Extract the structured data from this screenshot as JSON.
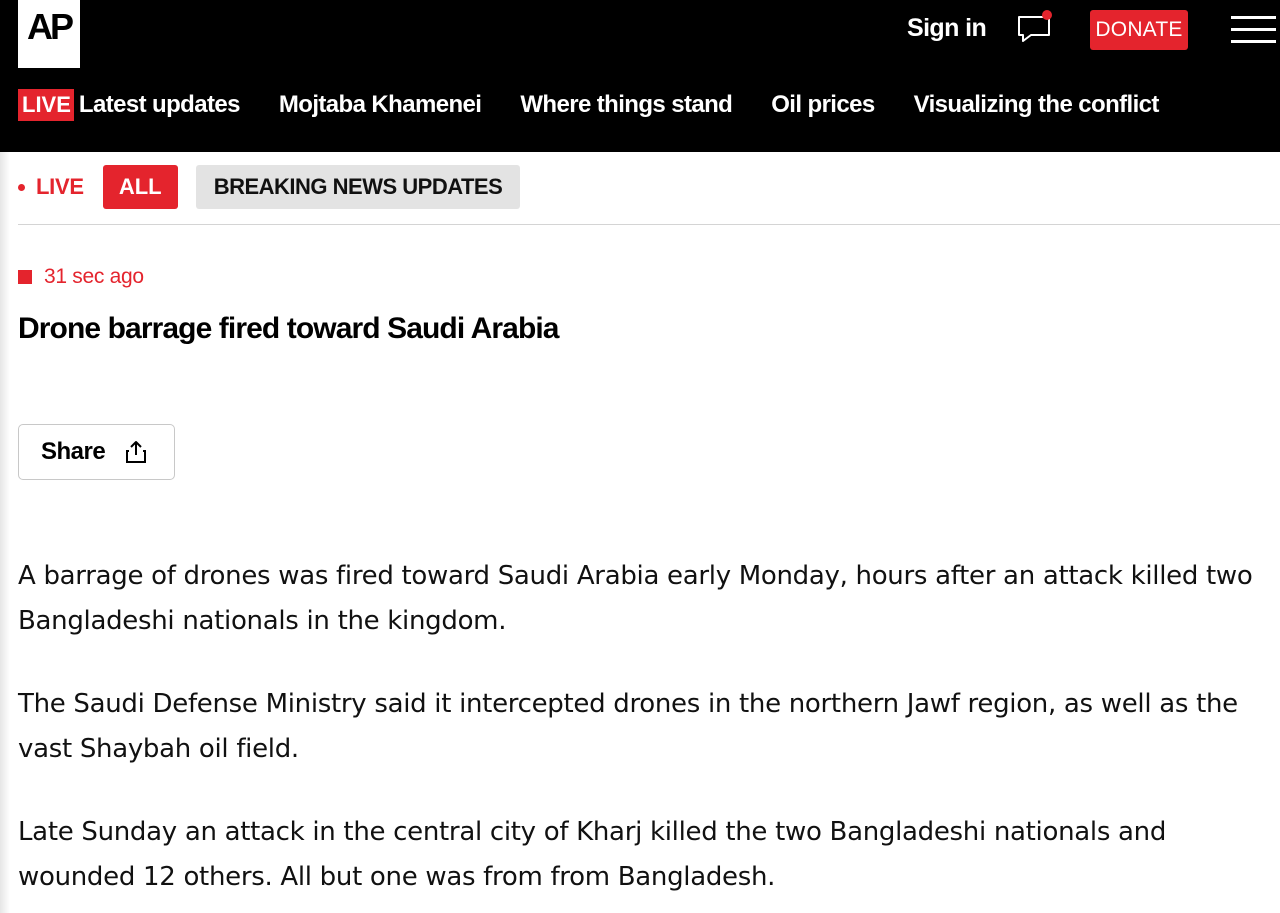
{
  "header": {
    "logo_text": "AP",
    "sign_in_label": "Sign in",
    "donate_label": "DONATE",
    "accent_color": "#e4242d",
    "icons": [
      "comments-icon",
      "hamburger-menu-icon"
    ]
  },
  "nav": {
    "live_badge": "LIVE",
    "items": [
      {
        "label": "Latest updates"
      },
      {
        "label": "Mojtaba Khamenei"
      },
      {
        "label": "Where things stand"
      },
      {
        "label": "Oil prices"
      },
      {
        "label": "Visualizing the conflict"
      }
    ]
  },
  "filters": {
    "live_label": "LIVE",
    "all_label": "ALL",
    "breaking_label": "BREAKING NEWS UPDATES"
  },
  "post": {
    "timestamp": "31 sec ago",
    "headline": "Drone barrage fired toward Saudi Arabia",
    "share_label": "Share",
    "paragraphs": [
      "A barrage of drones was fired toward Saudi Arabia early Monday, hours after an attack killed two Bangladeshi nationals in the kingdom.",
      "The Saudi Defense Ministry said it intercepted drones in the northern Jawf region, as well as the vast Shaybah oil field.",
      "Late Sunday an attack in the central city of Kharj killed the two Bangladeshi nationals and wounded 12 others. All but one was from from Bangladesh."
    ]
  }
}
